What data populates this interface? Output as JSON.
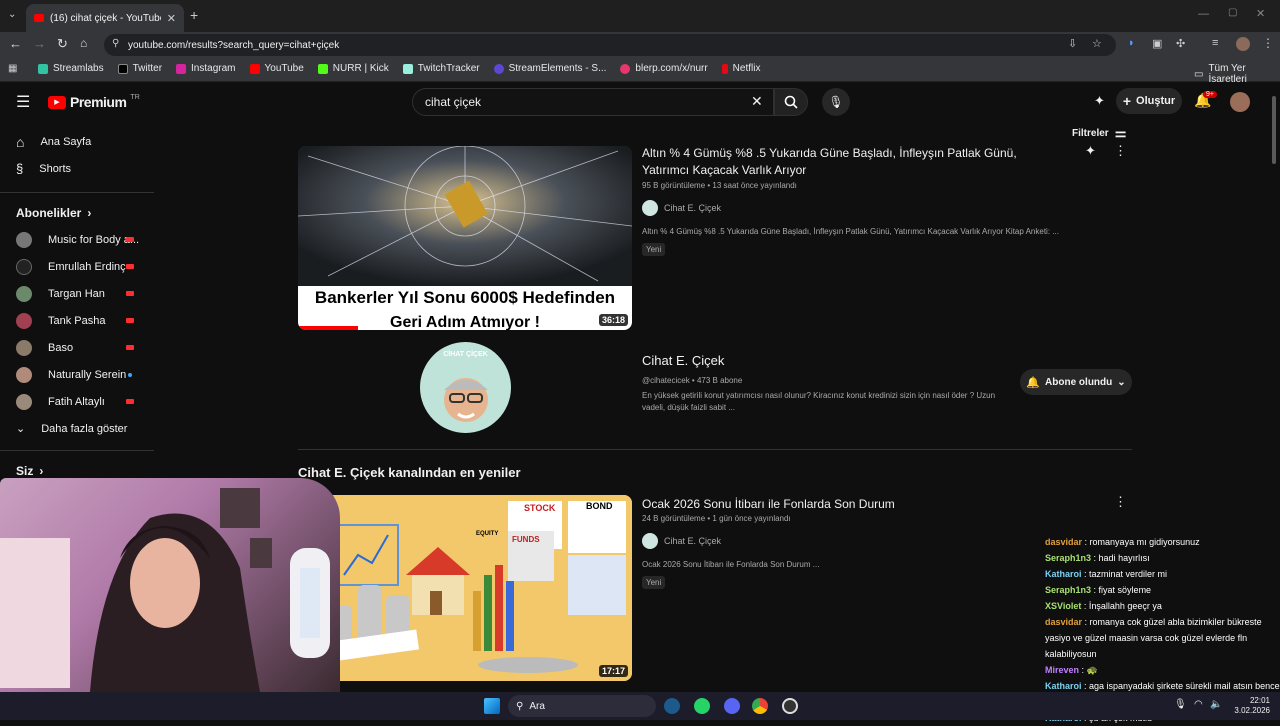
{
  "browser": {
    "tab_title": "(16) cihat çiçek - YouTube",
    "url": "youtube.com/results?search_query=cihat+çiçek",
    "bookmarks": [
      "Streamlabs",
      "Twitter",
      "Instagram",
      "YouTube",
      "NURR | Kick",
      "TwitchTracker",
      "StreamElements - S...",
      "blerp.com/x/nurr",
      "Netflix"
    ],
    "all_bookmarks": "Tüm Yer İşaretleri"
  },
  "header": {
    "logo": "Premium",
    "logo_sup": "TR",
    "search_value": "cihat çiçek",
    "create_label": "Oluştur",
    "notif_count": "9+"
  },
  "sidebar": {
    "home": "Ana Sayfa",
    "shorts": "Shorts",
    "subs_title": "Abonelikler",
    "subs": [
      {
        "name": "Music for Body a...",
        "live": true
      },
      {
        "name": "Emrullah Erdinç",
        "live": true
      },
      {
        "name": "Targan Han",
        "live": true
      },
      {
        "name": "Tank Pasha",
        "live": true
      },
      {
        "name": "Baso",
        "live": true
      },
      {
        "name": "Naturally Serein",
        "live": false
      },
      {
        "name": "Fatih Altaylı",
        "live": true
      }
    ],
    "show_more": "Daha fazla göster",
    "you": "Siz"
  },
  "filters_label": "Filtreler",
  "video1": {
    "title": "Altın % 4 Gümüş %8 .5 Yukarıda Güne Başladı, İnfleyşın Patlak Günü, Yatırımcı Kaçacak Varlık Arıyor",
    "meta": "95 B görüntüleme • 13 saat önce yayınlandı",
    "channel": "Cihat E. Çiçek",
    "desc": "Altın % 4 Gümüş %8 .5 Yukarıda Güne Başladı, İnfleyşın Patlak Günü, Yatırımcı Kaçacak Varlık Arıyor Kitap Anketi: ...",
    "badge": "Yeni",
    "thumb_text_1": "Bankerler Yıl Sonu 6000$ Hedefinden",
    "thumb_text_2": "Geri Adım Atmıyor !",
    "duration": "36:18"
  },
  "channel_card": {
    "name": "Cihat E. Çiçek",
    "meta": "@cihatecicek • 473 B abone",
    "desc": "En yüksek getirili konut yatırımcısı nasıl olunur? Kiracınız konut kredinizi sizin için nasıl öder ? Uzun vadeli, düşük faizli sabit ...",
    "subscribed_label": "Abone olundu",
    "avatar_text": "CİHAT ÇİÇEK"
  },
  "section_title": "Cihat E. Çiçek kanalından en yeniler",
  "video2": {
    "title": "Ocak 2026 Sonu İtibarı ile Fonlarda Son Durum",
    "meta": "24 B görüntüleme • 1 gün önce yayınlandı",
    "channel": "Cihat E. Çiçek",
    "desc": "Ocak 2026 Sonu İtibarı ile Fonlarda Son Durum ...",
    "badge": "Yeni",
    "duration": "17:17",
    "thumb_labels": [
      "STOCK",
      "BOND",
      "FUNDS",
      "EQUITY"
    ]
  },
  "chat": [
    {
      "user": "dasvidar",
      "text": "romanyaya mı gidiyorsunuz",
      "color": "#e0a040"
    },
    {
      "user": "Seraph1n3",
      "text": "hadi hayırlısı",
      "color": "#a8e070"
    },
    {
      "user": "Katharoi",
      "text": "tazminat verdiler mi",
      "color": "#7ad0f0"
    },
    {
      "user": "Seraph1n3",
      "text": "fiyat söyleme",
      "color": "#a8e070"
    },
    {
      "user": "XSViolet",
      "text": "İnşallahh geeçr ya",
      "color": "#a8e070"
    },
    {
      "user": "dasvidar",
      "text": "romanya cok güzel abla bizimkiler bükreste yasiyo ve güzel maasin varsa cok güzel evlerde fln kalabiliyosun",
      "color": "#e0a040"
    },
    {
      "user": "Mireven",
      "text": "🐢",
      "color": "#c080ff"
    },
    {
      "user": "Katharoi",
      "text": "aga ispanyadaki şirkete sürekli mail atsın bence oraya gidin benim kuzen ispanyaya gitti",
      "color": "#7ad0f0"
    },
    {
      "user": "Katharoi",
      "text": "şu an çok mutlu",
      "color": "#7ad0f0"
    }
  ],
  "taskbar": {
    "search": "Ara",
    "time": "22:01",
    "date": "3.02.2026"
  }
}
